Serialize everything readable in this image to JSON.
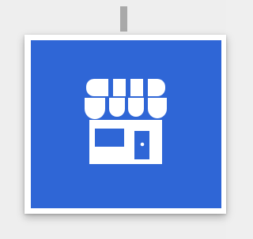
{
  "icon": {
    "name": "storefront-icon"
  },
  "colors": {
    "background": "#eeeeee",
    "frame": "#ffffff",
    "card": "#2f66d6",
    "icon": "#ffffff",
    "hanger": "#a9a9a9"
  }
}
